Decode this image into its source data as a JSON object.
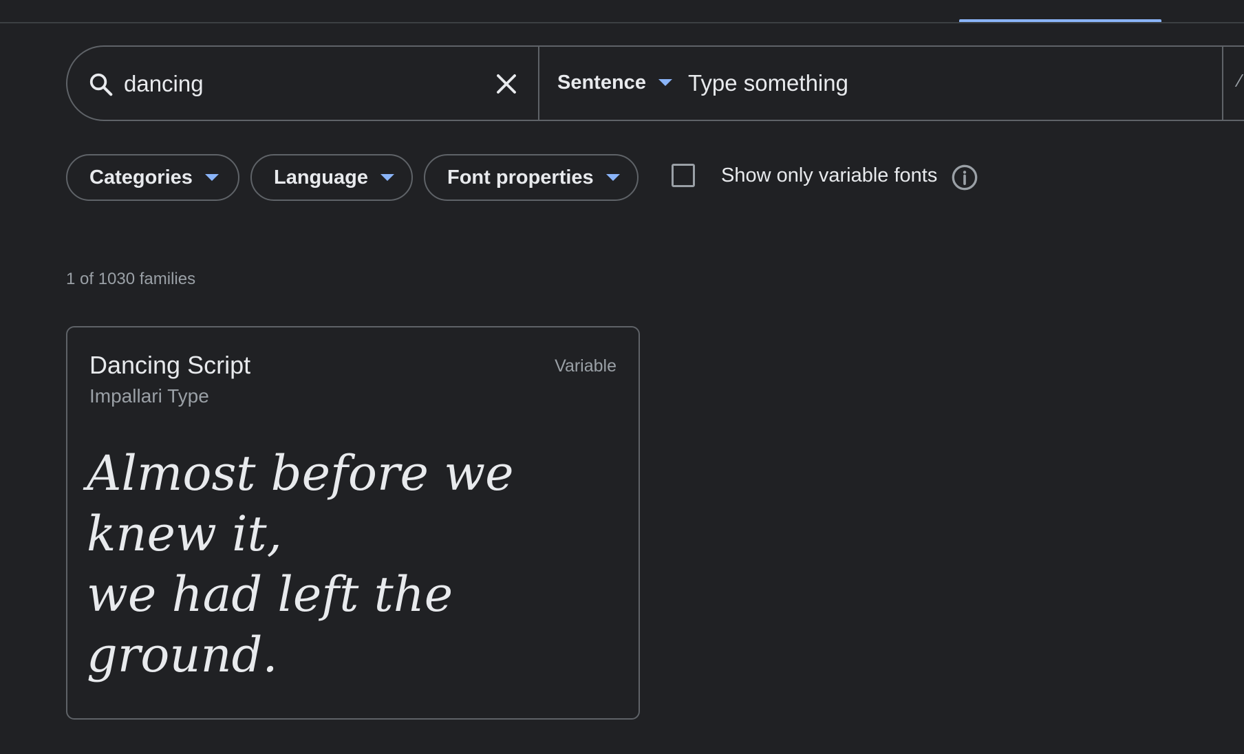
{
  "search": {
    "value": "dancing",
    "preview_mode": "Sentence",
    "preview_placeholder": "Type something"
  },
  "filters": {
    "categories_label": "Categories",
    "language_label": "Language",
    "font_properties_label": "Font properties",
    "variable_toggle_label": "Show only variable fonts",
    "variable_checked": false
  },
  "results": {
    "count_text": "1 of 1030 families"
  },
  "font_card": {
    "family_name": "Dancing Script",
    "foundry": "Impallari Type",
    "badge": "Variable",
    "sample_line1": "Almost before we knew it,",
    "sample_line2": "we had left the ground."
  },
  "colors": {
    "background": "#202124",
    "accent": "#8ab4f8",
    "border": "#5f6368",
    "text_primary": "#e8eaed",
    "text_secondary": "#9aa0a6"
  },
  "icons": {
    "search": "search-icon",
    "clear": "close-icon",
    "dropdown": "caret-down-icon",
    "info": "info-icon"
  }
}
